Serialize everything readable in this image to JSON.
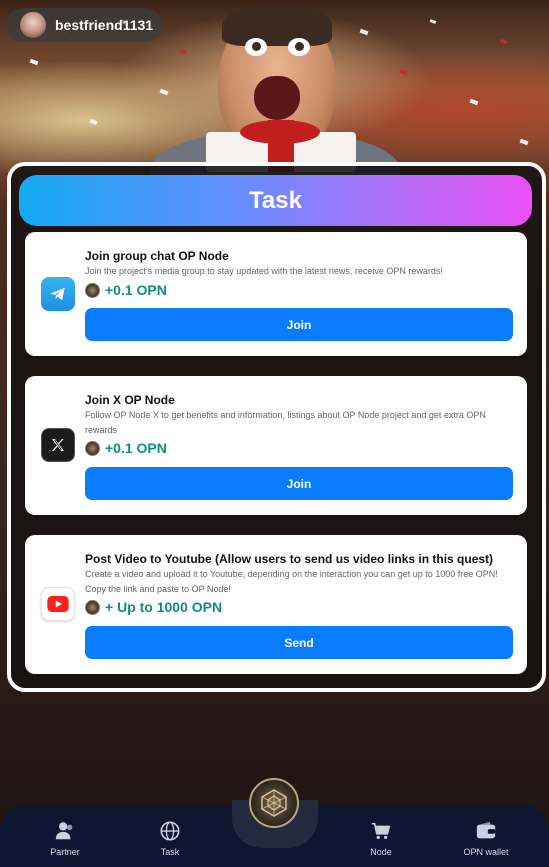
{
  "user": {
    "name": "bestfriend1131"
  },
  "header": {
    "title": "Task"
  },
  "tasks": [
    {
      "title": "Join group chat OP Node",
      "description": "Join the project's media group to stay updated with the latest news, receive OPN rewards!",
      "reward": "+0.1 OPN",
      "button": "Join",
      "icon": "telegram-icon"
    },
    {
      "title": "Join X OP Node",
      "description": "Follow OP Node X to get benefits and information, listings about OP Node project and get extra OPN rewards",
      "reward": "+0.1 OPN",
      "button": "Join",
      "icon": "x-logo-icon"
    },
    {
      "title": "Post Video to Youtube (Allow users to send us video links in this quest)",
      "description": "Create a video and upload it to Youtube, depending on the interaction you can get up to 1000 free OPN! Copy the link and paste to OP Node!",
      "reward": "+ Up to 1000 OPN",
      "button": "Send",
      "icon": "youtube-icon"
    }
  ],
  "nav": {
    "items": [
      {
        "label": "Partner",
        "icon": "partner-icon"
      },
      {
        "label": "Task",
        "icon": "globe-icon"
      },
      {
        "label": "Node",
        "icon": "cart-icon"
      },
      {
        "label": "OPN wallet",
        "icon": "wallet-icon"
      }
    ]
  },
  "colors": {
    "accent": "#0a7cff",
    "reward": "#0f8f7a",
    "header_gradient": [
      "#12aaf2",
      "#ea4ff5"
    ],
    "nav_bg": "#0e1530"
  }
}
